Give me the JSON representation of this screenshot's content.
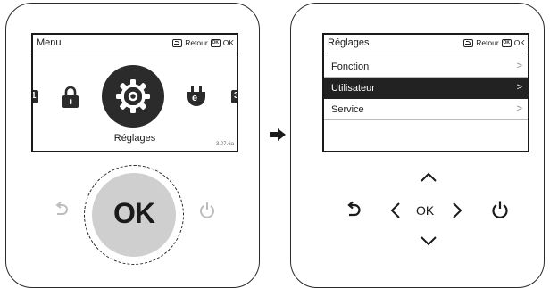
{
  "left_panel": {
    "header": {
      "title": "Menu",
      "back_label": "Retour",
      "ok_label": "OK",
      "ok_icon_text": "OK"
    },
    "carousel": {
      "items": [
        "lock-icon",
        "settings-gear-icon",
        "electric-plug-icon"
      ],
      "selected_label": "Réglages",
      "edge_left_text": "1",
      "edge_right_text": "3",
      "plug_badge": "e",
      "version": "3.07.6a"
    },
    "dial": {
      "label": "OK"
    }
  },
  "right_panel": {
    "header": {
      "title": "Réglages",
      "back_label": "Retour",
      "ok_label": "OK",
      "ok_icon_text": "OK"
    },
    "items": [
      {
        "label": "Fonction",
        "chevron": ">",
        "selected": false
      },
      {
        "label": "Utilisateur",
        "chevron": ">",
        "selected": true
      },
      {
        "label": "Service",
        "chevron": ">",
        "selected": false
      }
    ],
    "dpad": {
      "center_label": "OK"
    }
  },
  "colors": {
    "outline": "#2a2a2a",
    "selected_bg": "#222222",
    "dial": "#cfcfcf"
  }
}
